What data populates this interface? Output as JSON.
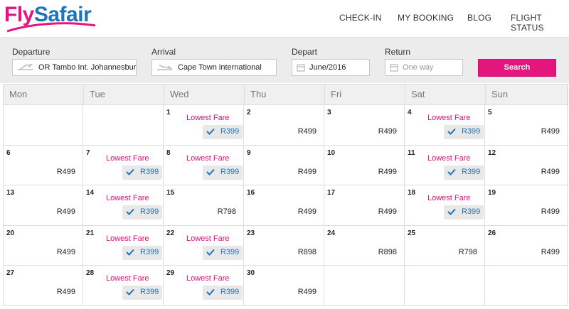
{
  "brand": {
    "fly": "Fly",
    "safair": "Safair",
    "pink": "#e5157e",
    "blue": "#1c75bc"
  },
  "nav": {
    "checkin": "CHECK-IN",
    "booking": "MY BOOKING",
    "blog": "BLOG",
    "status": "FLIGHT STATUS"
  },
  "search": {
    "departure_label": "Departure",
    "departure_value": "OR Tambo Int. Johannesbur",
    "arrival_label": "Arrival",
    "arrival_value": "Cape Town international",
    "depart_label": "Depart",
    "depart_value": "June/2016",
    "return_label": "Return",
    "return_placeholder": "One way",
    "search_button": "Search"
  },
  "calendar": {
    "days_of_week": [
      "Mon",
      "Tue",
      "Wed",
      "Thu",
      "Fri",
      "Sat",
      "Sun"
    ],
    "lowest_fare_label": "Lowest Fare",
    "weeks": [
      [
        null,
        null,
        {
          "day": "1",
          "lowest": true,
          "price": "R399"
        },
        {
          "day": "2",
          "price": "R499"
        },
        {
          "day": "3",
          "price": "R499"
        },
        {
          "day": "4",
          "lowest": true,
          "price": "R399"
        },
        {
          "day": "5",
          "price": "R499"
        }
      ],
      [
        {
          "day": "6",
          "price": "R499"
        },
        {
          "day": "7",
          "lowest": true,
          "price": "R399"
        },
        {
          "day": "8",
          "lowest": true,
          "price": "R399"
        },
        {
          "day": "9",
          "price": "R499"
        },
        {
          "day": "10",
          "price": "R499"
        },
        {
          "day": "11",
          "lowest": true,
          "price": "R399"
        },
        {
          "day": "12",
          "price": "R499"
        }
      ],
      [
        {
          "day": "13",
          "price": "R499"
        },
        {
          "day": "14",
          "lowest": true,
          "price": "R399"
        },
        {
          "day": "15",
          "price": "R798"
        },
        {
          "day": "16",
          "price": "R499"
        },
        {
          "day": "17",
          "price": "R499"
        },
        {
          "day": "18",
          "lowest": true,
          "price": "R399"
        },
        {
          "day": "19",
          "price": "R499"
        }
      ],
      [
        {
          "day": "20",
          "price": "R499"
        },
        {
          "day": "21",
          "lowest": true,
          "price": "R399"
        },
        {
          "day": "22",
          "lowest": true,
          "price": "R399"
        },
        {
          "day": "23",
          "price": "R898"
        },
        {
          "day": "24",
          "price": "R898"
        },
        {
          "day": "25",
          "price": "R798"
        },
        {
          "day": "26",
          "price": "R499"
        }
      ],
      [
        {
          "day": "27",
          "price": "R499"
        },
        {
          "day": "28",
          "lowest": true,
          "price": "R399"
        },
        {
          "day": "29",
          "lowest": true,
          "price": "R399"
        },
        {
          "day": "30",
          "price": "R499"
        },
        null,
        null,
        null
      ]
    ]
  }
}
